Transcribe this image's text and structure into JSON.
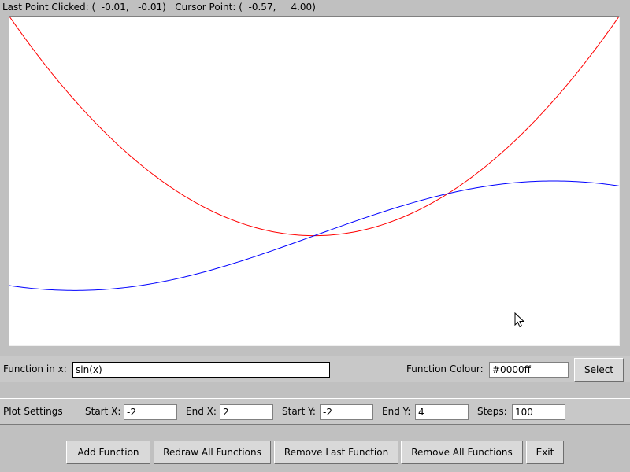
{
  "status": {
    "last_point_label": "Last Point Clicked: (",
    "last_point_x": "-0.01",
    "last_point_y": "-0.01",
    "cursor_point_label": "Cursor Point: (",
    "cursor_point_x": "-0.57",
    "cursor_point_y": "4.00"
  },
  "plot": {
    "functions": [
      {
        "expr": "x**2",
        "color": "#ff0000"
      },
      {
        "expr": "sin(x)",
        "color": "#0000ff"
      }
    ],
    "x_range": [
      -2,
      2
    ],
    "y_range": [
      -2,
      4
    ],
    "background": "#ffffff"
  },
  "chart_data": {
    "type": "line",
    "series": [
      {
        "color": "#ff0000",
        "expr": "x**2"
      },
      {
        "color": "#0000ff",
        "expr": "sin(x)"
      }
    ],
    "xlim": [
      -2,
      2
    ],
    "ylim": [
      -2,
      4
    ],
    "grid": false
  },
  "function_panel": {
    "function_label": "Function in x:",
    "function_value": "sin(x)",
    "colour_label": "Function Colour:",
    "colour_value": "#0000ff",
    "select_label": "Select"
  },
  "plot_settings": {
    "title": "Plot Settings",
    "start_x_label": "Start X:",
    "start_x_value": "-2",
    "end_x_label": "End X:",
    "end_x_value": "2",
    "start_y_label": "Start Y:",
    "start_y_value": "-2",
    "end_y_label": "End Y:",
    "end_y_value": "4",
    "steps_label": "Steps:",
    "steps_value": "100"
  },
  "buttons": {
    "add_function": "Add Function",
    "redraw_all": "Redraw All Functions",
    "remove_last": "Remove Last Function",
    "remove_all": "Remove All Functions",
    "exit": "Exit"
  }
}
